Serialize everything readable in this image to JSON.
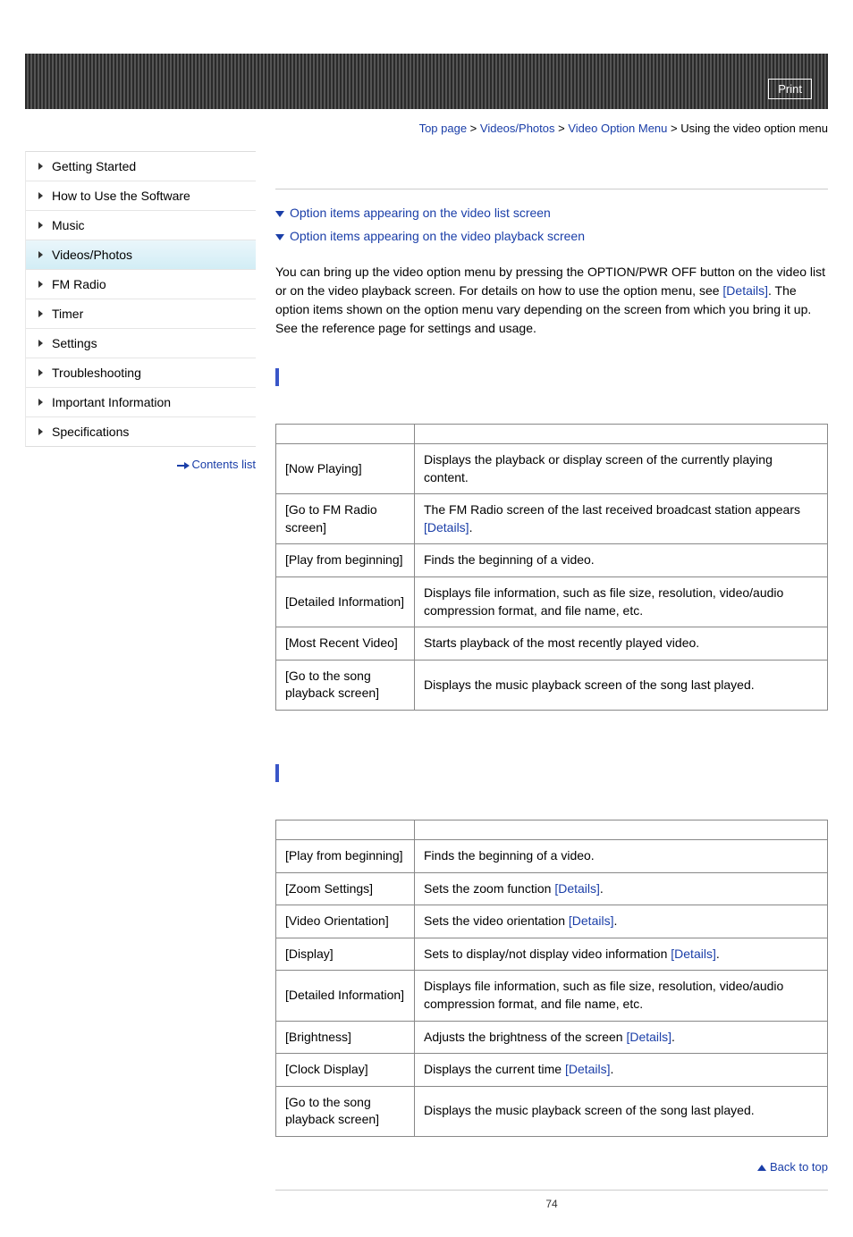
{
  "print_label": "Print",
  "breadcrumb": {
    "top": "Top page",
    "cat": "Videos/Photos",
    "sub": "Video Option Menu",
    "page": "Using the video option menu",
    "sep": " > "
  },
  "sidebar": {
    "items": [
      {
        "label": "Getting Started",
        "active": false
      },
      {
        "label": "How to Use the Software",
        "active": false
      },
      {
        "label": "Music",
        "active": false
      },
      {
        "label": "Videos/Photos",
        "active": true
      },
      {
        "label": "FM Radio",
        "active": false
      },
      {
        "label": "Timer",
        "active": false
      },
      {
        "label": "Settings",
        "active": false
      },
      {
        "label": "Troubleshooting",
        "active": false
      },
      {
        "label": "Important Information",
        "active": false
      },
      {
        "label": "Specifications",
        "active": false
      }
    ],
    "contents_list": "Contents list"
  },
  "jump_links": {
    "list_screen": "Option items appearing on the video list screen",
    "playback_screen": "Option items appearing on the video playback screen"
  },
  "intro": {
    "t1": "You can bring up the video option menu by pressing the OPTION/PWR OFF button on the video list or on the video playback screen. For details on how to use the option menu, see ",
    "details": "[Details]",
    "t2": ". The option items shown on the option menu vary depending on the screen from which you bring it up. See the reference page for settings and usage."
  },
  "table1": {
    "rows": [
      {
        "item": "[Now Playing]",
        "desc": "Displays the playback or display screen of the currently playing content."
      },
      {
        "item": "[Go to FM Radio screen]",
        "desc_pre": "The FM Radio screen of the last received broadcast station appears ",
        "link": "[Details]",
        "desc_post": "."
      },
      {
        "item": "[Play from beginning]",
        "desc": "Finds the beginning of a video."
      },
      {
        "item": "[Detailed Information]",
        "desc": "Displays file information, such as file size, resolution, video/audio compression format, and file name, etc."
      },
      {
        "item": "[Most Recent Video]",
        "desc": "Starts playback of the most recently played video."
      },
      {
        "item": "[Go to the song playback screen]",
        "desc": "Displays the music playback screen of the song last played."
      }
    ]
  },
  "table2": {
    "rows": [
      {
        "item": "[Play from beginning]",
        "desc": "Finds the beginning of a video."
      },
      {
        "item": "[Zoom Settings]",
        "desc_pre": "Sets the zoom function ",
        "link": "[Details]",
        "desc_post": "."
      },
      {
        "item": "[Video Orientation]",
        "desc_pre": "Sets the video orientation ",
        "link": "[Details]",
        "desc_post": "."
      },
      {
        "item": "[Display]",
        "desc_pre": "Sets to display/not display video information ",
        "link": "[Details]",
        "desc_post": "."
      },
      {
        "item": "[Detailed Information]",
        "desc": "Displays file information, such as file size, resolution, video/audio compression format, and file name, etc."
      },
      {
        "item": "[Brightness]",
        "desc_pre": "Adjusts the brightness of the screen ",
        "link": "[Details]",
        "desc_post": "."
      },
      {
        "item": "[Clock Display]",
        "desc_pre": "Displays the current time ",
        "link": "[Details]",
        "desc_post": "."
      },
      {
        "item": "[Go to the song playback screen]",
        "desc": "Displays the music playback screen of the song last played."
      }
    ]
  },
  "back_to_top": "Back to top",
  "page_number": "74"
}
